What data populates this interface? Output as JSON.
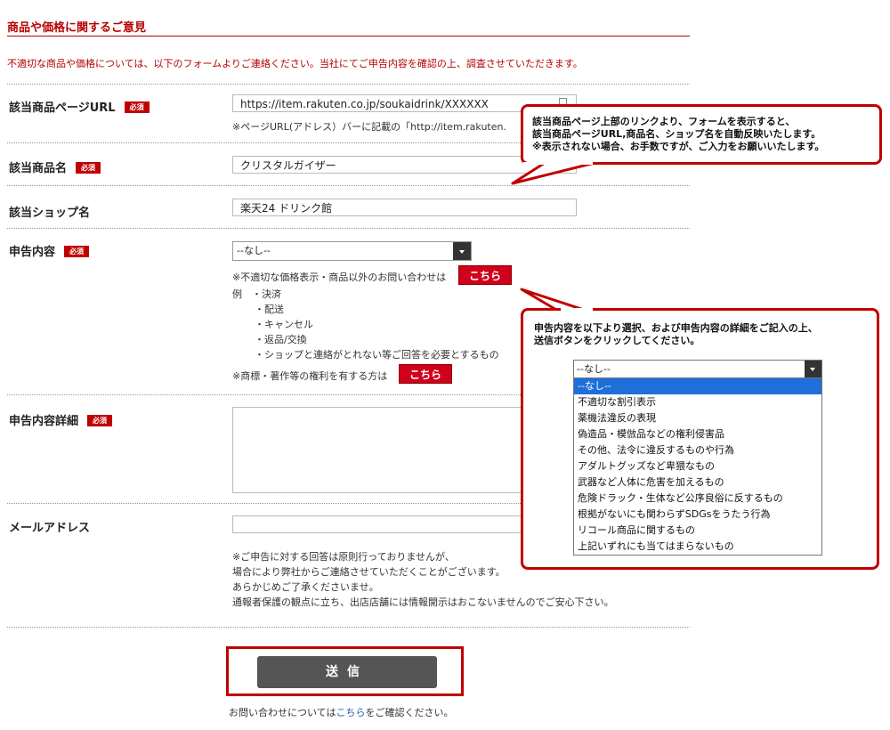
{
  "header": {
    "title": "商品や価格に関するご意見",
    "intro": "不適切な商品や価格については、以下のフォームよりご連絡ください。当社にてご申告内容を確認の上、調査させていただきます。"
  },
  "required_badge": "必須",
  "fields": {
    "url": {
      "label": "該当商品ページURL",
      "value": "https://item.rakuten.co.jp/soukaidrink/XXXXXX",
      "note": "※ページURL(アドレス）バーに記載の「http://item.rakuten."
    },
    "product": {
      "label": "該当商品名",
      "value": "クリスタルガイザー"
    },
    "shop": {
      "label": "該当ショップ名",
      "value": "楽天24 ドリンク館"
    },
    "report": {
      "label": "申告内容",
      "selected": "--なし--",
      "other_note": "※不適切な価格表示・商品以外のお問い合わせは",
      "kochira_label": "こちら",
      "examples": [
        "例　・決済",
        "・配送",
        "・キャンセル",
        "・返品/交換",
        "・ショップと連絡がとれない等ご回答を必要とするもの"
      ],
      "rights_note": "※商標・著作等の権利を有する方は"
    },
    "detail": {
      "label": "申告内容詳細",
      "value": ""
    },
    "email": {
      "label": "メールアドレス",
      "value": "",
      "notes": [
        "※ご申告に対する回答は原則行っておりませんが、",
        "場合により弊社からご連絡させていただくことがございます。",
        "あらかじめご了承くださいませ。",
        "通報者保護の観点に立ち、出店店舗には情報開示はおこないませんのでご安心下さい。"
      ]
    }
  },
  "submit_label": "送信",
  "footer": {
    "prefix": "お問い合わせについては",
    "link": "こちら",
    "suffix": "をご確認ください。"
  },
  "callout_top": {
    "lines": [
      "該当商品ページ上部のリンクより、フォームを表示すると、",
      "該当商品ページURL,商品名、ショップ名を自動反映いたします。",
      "※表示されない場合、お手数ですが、ご入力をお願いいたします。"
    ]
  },
  "callout_bottom": {
    "lines": [
      "申告内容を以下より選択、および申告内容の詳細をご記入の上、",
      "送信ボタンをクリックしてください。"
    ],
    "dropdown_selected": "--なし--",
    "options": [
      "--なし--",
      "不適切な割引表示",
      "薬機法違反の表現",
      "偽造品・模倣品などの権利侵害品",
      "その他、法令に違反するものや行為",
      "アダルトグッズなど卑猥なもの",
      "武器など人体に危害を加えるもの",
      "危険ドラック・生体など公序良俗に反するもの",
      "根拠がないにも関わらずSDGsをうたう行為",
      "リコール商品に関するもの",
      "上記いずれにも当てはまらないもの"
    ]
  },
  "colors": {
    "accent": "#c00000",
    "link": "#1a5fb4",
    "selected_option": "#1e6fd9",
    "submit": "#555555"
  }
}
